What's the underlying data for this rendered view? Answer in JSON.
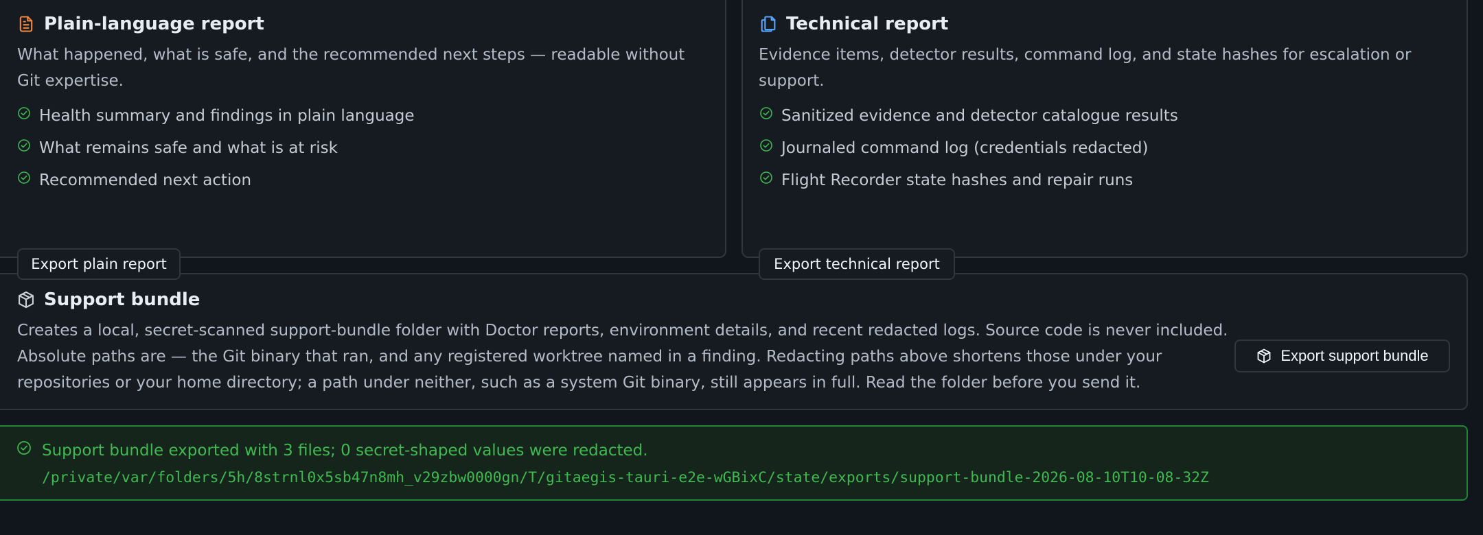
{
  "plain_report": {
    "title": "Plain-language report",
    "icon": "file-text-icon",
    "description": "What happened, what is safe, and the recommended next steps — readable without Git expertise.",
    "items": [
      "Health summary and findings in plain language",
      "What remains safe and what is at risk",
      "Recommended next action"
    ],
    "export_label": "Export plain report"
  },
  "technical_report": {
    "title": "Technical report",
    "icon": "copy-files-icon",
    "description": "Evidence items, detector results, command log, and state hashes for escalation or support.",
    "items": [
      "Sanitized evidence and detector catalogue results",
      "Journaled command log (credentials redacted)",
      "Flight Recorder state hashes and repair runs"
    ],
    "export_label": "Export technical report"
  },
  "support_bundle": {
    "title": "Support bundle",
    "icon": "package-icon",
    "description_lines": [
      "Creates a local, secret-scanned support-bundle folder with Doctor reports, environment details, and recent redacted logs. Source code is never included.",
      "Absolute paths are — the Git binary that ran, and any registered worktree named in a finding. Redacting paths above shortens those under your",
      "repositories or your home directory; a path under neither, such as a system Git binary, still appears in full. Read the folder before you send it."
    ],
    "export_label": "Export support bundle"
  },
  "success_notice": {
    "message": "Support bundle exported with 3 files; 0 secret-shaped values were redacted.",
    "path": "/private/var/folders/5h/8strnl0x5sb47n8mh_v29zbw0000gn/T/gitaegis-tauri-e2e-wGBixC/state/exports/support-bundle-2026-08-10T10-08-32Z"
  },
  "colors": {
    "background": "#11161d",
    "card": "#161b22",
    "border": "#30363d",
    "success": "#3fb950",
    "plain_icon": "#f0883e",
    "technical_icon": "#58a6ff"
  }
}
